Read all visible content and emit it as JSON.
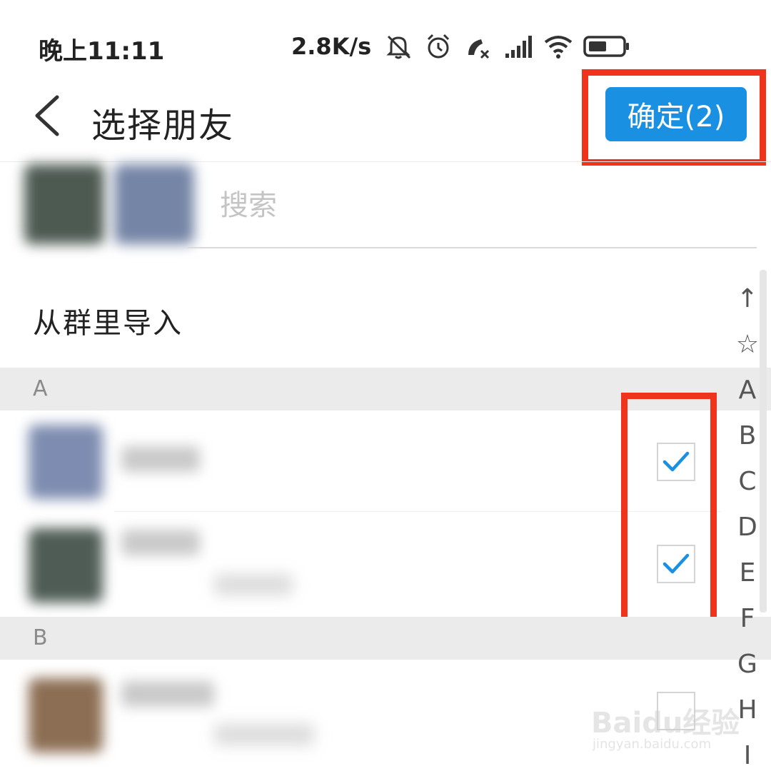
{
  "status_bar": {
    "time": "晚上11:11",
    "net_speed": "2.8K/s",
    "icons": [
      "bell-muted-icon",
      "alarm-icon",
      "call-missed-icon",
      "signal-icon",
      "wifi-icon",
      "battery-icon"
    ]
  },
  "header": {
    "back_icon": "chevron-left-icon",
    "title": "选择朋友",
    "confirm_label": "确定(2)"
  },
  "search": {
    "placeholder": "搜索"
  },
  "import_from_group": "从群里导入",
  "sections": [
    {
      "letter": "A",
      "contacts": [
        {
          "checked": true
        },
        {
          "checked": true
        }
      ]
    },
    {
      "letter": "B",
      "contacts": [
        {
          "checked": false
        }
      ]
    }
  ],
  "index_bar": [
    "↑",
    "☆",
    "A",
    "B",
    "C",
    "D",
    "E",
    "F",
    "G",
    "H",
    "I"
  ],
  "watermark": {
    "logo": "Baidu经验",
    "url": "jingyan.baidu.com"
  },
  "colors": {
    "accent": "#1a90e2",
    "highlight": "#f0341c",
    "section_bg": "#ebebeb"
  }
}
